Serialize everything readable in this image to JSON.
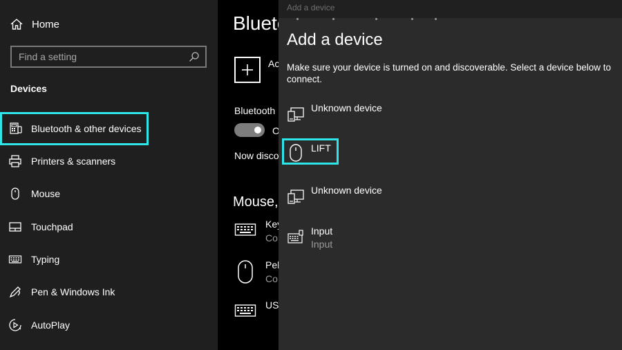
{
  "sidebar": {
    "home_label": "Home",
    "search_placeholder": "Find a setting",
    "section_title": "Devices",
    "items": [
      {
        "label": "Bluetooth & other devices",
        "icon": "bluetooth-devices-icon",
        "selected": true
      },
      {
        "label": "Printers & scanners",
        "icon": "printer-icon"
      },
      {
        "label": "Mouse",
        "icon": "mouse-icon"
      },
      {
        "label": "Touchpad",
        "icon": "touchpad-icon"
      },
      {
        "label": "Typing",
        "icon": "keyboard-icon"
      },
      {
        "label": "Pen & Windows Ink",
        "icon": "pen-icon"
      },
      {
        "label": "AutoPlay",
        "icon": "autoplay-icon"
      }
    ]
  },
  "main": {
    "title": "Blueto",
    "add_label": "Ac",
    "bluetooth_label": "Bluetooth",
    "toggle_state": "O",
    "discover_text": "Now disco",
    "mouse_heading": "Mouse,",
    "devices": [
      {
        "name": "Key",
        "sub": "Co",
        "icon": "keyboard-icon"
      },
      {
        "name": "Peb",
        "sub": "Co",
        "icon": "mouse-icon"
      },
      {
        "name": "USI",
        "sub": "",
        "icon": "keyboard-icon"
      }
    ]
  },
  "dialog": {
    "titlebar": "Add a device",
    "heading": "Add a device",
    "instructions": "Make sure your device is turned on and discoverable. Select a device below to connect.",
    "devices": [
      {
        "name": "Unknown device",
        "sub": "",
        "icon": "display-device-icon"
      },
      {
        "name": "LIFT",
        "sub": "",
        "icon": "mouse-icon",
        "highlighted": true
      },
      {
        "name": "Unknown device",
        "sub": "",
        "icon": "display-device-icon"
      },
      {
        "name": "Input",
        "sub": "Input",
        "icon": "keyboard-icon"
      }
    ]
  },
  "colors": {
    "highlight": "#2ee6ea",
    "sidebar_bg": "#1f1f1f",
    "dialog_bg": "#2b2b2b",
    "main_bg": "#000000"
  }
}
